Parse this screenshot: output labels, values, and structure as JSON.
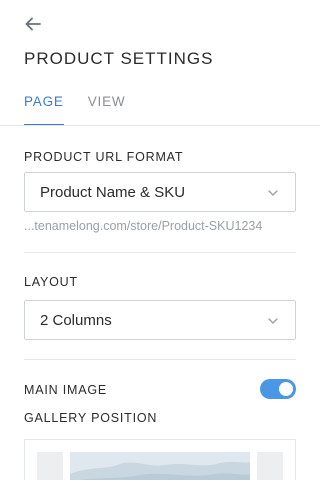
{
  "header": {
    "back_icon": "arrow-left-icon",
    "title": "PRODUCT SETTINGS"
  },
  "tabs": [
    {
      "label": "PAGE",
      "active": true
    },
    {
      "label": "VIEW",
      "active": false
    }
  ],
  "url_format": {
    "label": "PRODUCT URL FORMAT",
    "selected": "Product Name & SKU",
    "preview": "...tenamelong.com/store/Product-SKU1234"
  },
  "layout": {
    "label": "LAYOUT",
    "selected": "2 Columns"
  },
  "main_image": {
    "label": "MAIN IMAGE",
    "enabled": true
  },
  "gallery": {
    "label": "GALLERY POSITION"
  },
  "colors": {
    "accent": "#3a7bd5",
    "toggle_on": "#4a97e6"
  }
}
